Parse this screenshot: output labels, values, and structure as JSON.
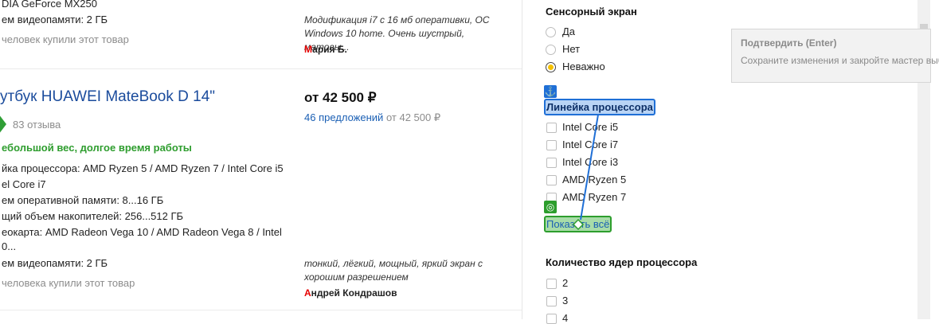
{
  "product1": {
    "spec_gpu": "DIA GeForce MX250",
    "spec_vram": "ем видеопамяти: 2 ГБ",
    "bought": "человек купили этот товар",
    "review_text": "Модификация i7 с 16 мб оперативки, ОС Windows 10 home. Очень шустрый, матовы...",
    "reviewer_first": "М",
    "reviewer_rest": "ария Б."
  },
  "product2": {
    "title": "утбук HUAWEI MateBook D 14\"",
    "price": "от 42 500 ₽",
    "offers": "46 предложений",
    "offers_from": "от 42 500 ₽",
    "reviews_count": "83 отзыва",
    "highlight": "ебольшой вес, долгое время работы",
    "specs": [
      "йка процессора: AMD Ryzen 5 / AMD Ryzen 7 / Intel Core i5",
      "el Core i7",
      "ем оперативной памяти: 8...16 ГБ",
      "щий объем накопителей: 256...512 ГБ",
      "еокарта: AMD Radeon Vega 10 / AMD Radeon Vega 8 / Intel",
      "0...",
      "ем видеопамяти: 2 ГБ"
    ],
    "bought": "человека купили этот товар",
    "review_text": "тонкий, лёгкий, мощный, яркий экран с хорошим разрешением",
    "reviewer_first": "А",
    "reviewer_rest": "ндрей Кондрашов"
  },
  "filters": {
    "touchscreen": {
      "heading": "Сенсорный экран",
      "options": [
        "Да",
        "Нет",
        "Неважно"
      ],
      "selected": "Неважно"
    },
    "cpu_line": {
      "heading": "Линейка процессора",
      "options": [
        "Intel Core i5",
        "Intel Core i7",
        "Intel Core i3",
        "AMD Ryzen 5",
        "AMD Ryzen 7"
      ],
      "show_all": "Показать всё"
    },
    "cores": {
      "heading": "Количество ядер процессора",
      "options": [
        "2",
        "3",
        "4"
      ]
    }
  },
  "tooltip": {
    "title": "Подтвердить (Enter)",
    "text": "Сохраните изменения и закройте мастер выбора."
  },
  "icons": {
    "anchor": "anchor-icon",
    "target": "target-icon",
    "move": "move-handle-icon"
  },
  "colors": {
    "link": "#1a4b9c",
    "green": "#2e9d2e",
    "highlight_blue": "#1f6fd6",
    "highlight_green": "#2d9e2d",
    "radio_selected": "#f5c100"
  }
}
